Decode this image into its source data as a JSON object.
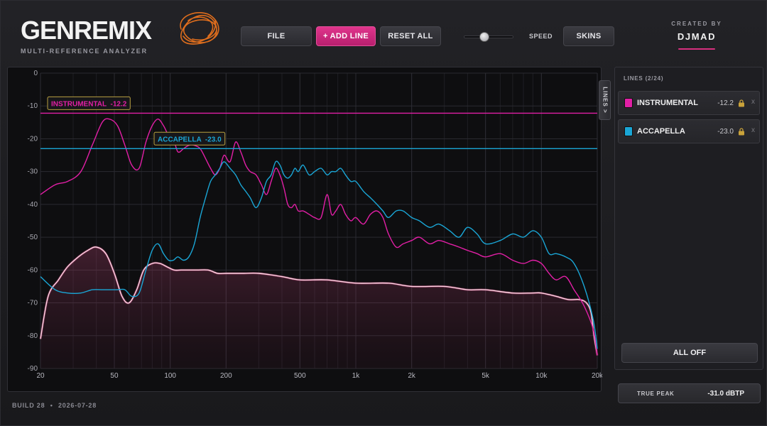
{
  "header": {
    "logo_text": "GENREMIX",
    "subtitle": "MULTI-REFERENCE ANALYZER",
    "buttons": {
      "file": "FILE",
      "add_line": "+ ADD LINE",
      "reset_all": "RESET ALL",
      "skins": "SKINS"
    },
    "speed_label": "SPEED",
    "speed_value": 0.4,
    "created_by": "CREATED BY",
    "author": "DJMAD"
  },
  "colors": {
    "accent": "#e0358c",
    "instrumental": "#e21fa6",
    "accapella": "#1aa6d6",
    "reference": "#ffd6e4"
  },
  "side_panel": {
    "tab_label": "LINES >",
    "header": "LINES  (2/24)",
    "lines": [
      {
        "name": "INSTRUMENTAL",
        "value": "-12.2",
        "color": "#e21fa6",
        "lock_icon": "lock-icon",
        "remove": "x"
      },
      {
        "name": "ACCAPELLA",
        "value": "-23.0",
        "color": "#1aa6d6",
        "lock_icon": "lock-icon",
        "remove": "x"
      }
    ],
    "all_off": "ALL OFF"
  },
  "true_peak": {
    "label": "TRUE PEAK",
    "value": "-31.0 dBTP"
  },
  "footer": {
    "build": "BUILD 28",
    "sep": "•",
    "date": "2026-07-28"
  },
  "chart_data": {
    "type": "line",
    "x_scale": "log",
    "xlim": [
      20,
      20000
    ],
    "ylim": [
      -90,
      0
    ],
    "grid": true,
    "y_ticks": [
      0,
      -10,
      -20,
      -30,
      -40,
      -50,
      -60,
      -70,
      -80,
      -90
    ],
    "x_ticks": [
      {
        "value": 20,
        "label": "20"
      },
      {
        "value": 50,
        "label": "50"
      },
      {
        "value": 100,
        "label": "100"
      },
      {
        "value": 200,
        "label": "200"
      },
      {
        "value": 500,
        "label": "500"
      },
      {
        "value": 1000,
        "label": "1k"
      },
      {
        "value": 2000,
        "label": "2k"
      },
      {
        "value": 5000,
        "label": "5k"
      },
      {
        "value": 10000,
        "label": "10k"
      },
      {
        "value": 20000,
        "label": "20k"
      }
    ],
    "reference_lines": [
      {
        "name": "INSTRUMENTAL",
        "value": -12.2,
        "label": "INSTRUMENTAL  -12.2",
        "color": "#e21fa6"
      },
      {
        "name": "ACCAPELLA",
        "value": -23.0,
        "label": "ACCAPELLA  -23.0",
        "color": "#1aa6d6"
      }
    ],
    "series": [
      {
        "color": "#e21fa6",
        "x": [
          20,
          24,
          28,
          33,
          38,
          43,
          47,
          52,
          57,
          62,
          68,
          74,
          80,
          86,
          92,
          98,
          104,
          110,
          118,
          126,
          135,
          145,
          155,
          165,
          175,
          185,
          195,
          210,
          225,
          240,
          255,
          270,
          290,
          310,
          330,
          350,
          370,
          390,
          410,
          430,
          450,
          470,
          490,
          520,
          560,
          600,
          650,
          700,
          740,
          780,
          830,
          880,
          940,
          1000,
          1100,
          1200,
          1300,
          1400,
          1500,
          1650,
          1800,
          2000,
          2200,
          2500,
          2800,
          3200,
          3600,
          4000,
          4500,
          5000,
          6000,
          7000,
          8000,
          9000,
          10000,
          11000,
          12000,
          13500,
          15000,
          17000,
          19000,
          20000
        ],
        "values": [
          -37,
          -34,
          -33,
          -30,
          -22,
          -15,
          -14,
          -16,
          -22,
          -28,
          -29,
          -21,
          -16,
          -14,
          -16,
          -19,
          -20,
          -24,
          -23,
          -22,
          -22,
          -23,
          -26,
          -29,
          -31,
          -29,
          -25,
          -27,
          -21,
          -24,
          -28,
          -30,
          -31,
          -34,
          -37,
          -33,
          -29,
          -31,
          -35,
          -40,
          -41,
          -40,
          -42,
          -42,
          -43,
          -44,
          -44,
          -37,
          -43,
          -42,
          -40,
          -43,
          -45,
          -44,
          -46,
          -43,
          -42,
          -44,
          -49,
          -53,
          -52,
          -51,
          -50,
          -52,
          -51,
          -52,
          -53,
          -54,
          -55,
          -56,
          -55,
          -57,
          -58,
          -57,
          -58,
          -61,
          -63,
          -62,
          -66,
          -71,
          -78,
          -86
        ]
      },
      {
        "color": "#1aa6d6",
        "x": [
          20,
          24,
          28,
          33,
          38,
          43,
          47,
          52,
          57,
          62,
          68,
          74,
          80,
          86,
          92,
          98,
          104,
          110,
          118,
          126,
          135,
          145,
          155,
          165,
          175,
          185,
          195,
          210,
          225,
          240,
          255,
          270,
          290,
          310,
          330,
          350,
          370,
          390,
          410,
          430,
          450,
          470,
          490,
          520,
          560,
          600,
          650,
          700,
          740,
          780,
          830,
          880,
          940,
          1000,
          1100,
          1200,
          1300,
          1400,
          1500,
          1650,
          1800,
          2000,
          2200,
          2500,
          2800,
          3200,
          3600,
          4000,
          4500,
          5000,
          6000,
          7000,
          8000,
          9000,
          10000,
          11000,
          12000,
          13500,
          15000,
          17000,
          19000,
          20000
        ],
        "values": [
          -62,
          -66,
          -67,
          -67,
          -66,
          -66,
          -66,
          -66,
          -66,
          -68,
          -67,
          -60,
          -54,
          -52,
          -55,
          -57,
          -57,
          -56,
          -57,
          -56,
          -52,
          -44,
          -38,
          -33,
          -31,
          -29,
          -27,
          -29,
          -31,
          -34,
          -36,
          -38,
          -41,
          -38,
          -33,
          -31,
          -27,
          -28,
          -31,
          -32,
          -31,
          -29,
          -30,
          -28,
          -31,
          -30,
          -29,
          -31,
          -30,
          -30,
          -29,
          -31,
          -33,
          -33,
          -36,
          -38,
          -40,
          -42,
          -44,
          -42,
          -42,
          -44,
          -45,
          -47,
          -46,
          -48,
          -50,
          -47,
          -49,
          -52,
          -51,
          -49,
          -50,
          -48,
          -50,
          -55,
          -55,
          -56,
          -58,
          -65,
          -75,
          -84
        ]
      },
      {
        "color": "#ffd6e4",
        "fill": true,
        "x": [
          20,
          22,
          25,
          28,
          32,
          36,
          40,
          45,
          50,
          55,
          60,
          66,
          72,
          80,
          88,
          96,
          105,
          115,
          125,
          140,
          160,
          180,
          200,
          250,
          300,
          400,
          500,
          700,
          1000,
          1500,
          2000,
          3000,
          4000,
          5000,
          7000,
          9000,
          10000,
          12000,
          14000,
          16000,
          17500,
          18500,
          19200,
          20000
        ],
        "values": [
          -81,
          -68,
          -63,
          -59,
          -56,
          -54,
          -53,
          -55,
          -61,
          -68,
          -70,
          -66,
          -60,
          -58,
          -58,
          -59,
          -60,
          -60,
          -60,
          -60,
          -60,
          -61,
          -61,
          -61,
          -61,
          -62,
          -63,
          -63,
          -64,
          -64,
          -65,
          -65,
          -66,
          -66,
          -67,
          -67,
          -67,
          -68,
          -69,
          -69,
          -70,
          -73,
          -80,
          -86
        ]
      }
    ]
  }
}
